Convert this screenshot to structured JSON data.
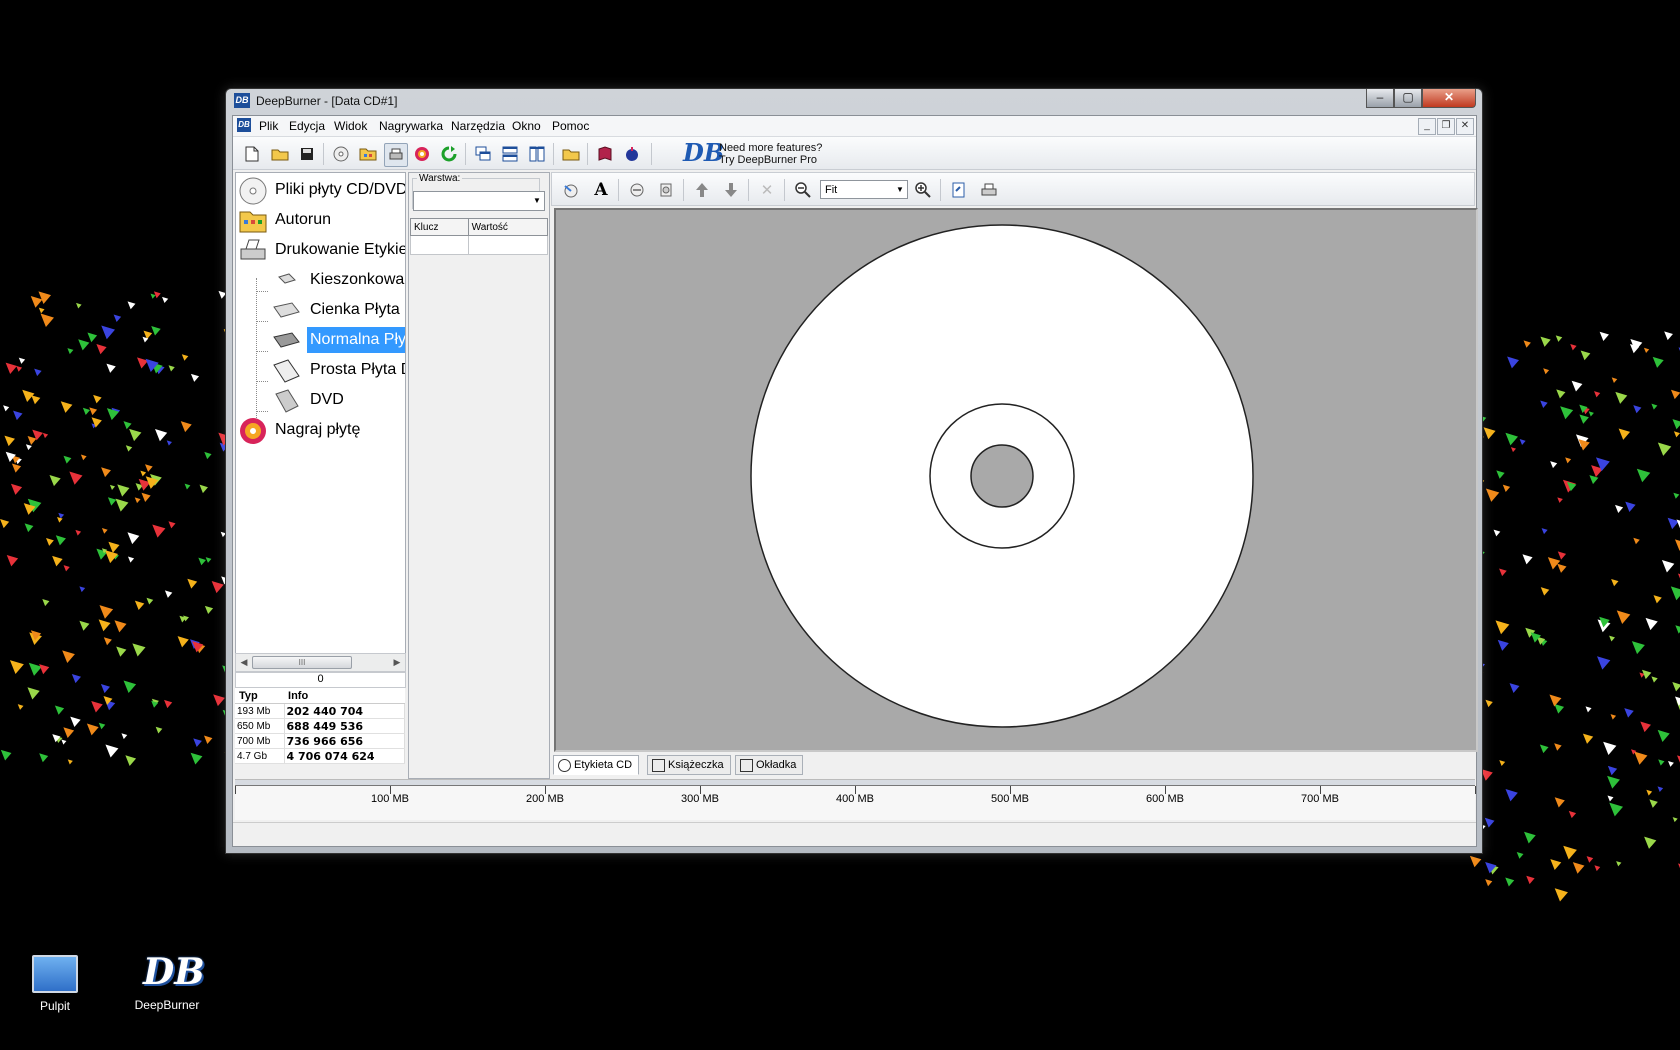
{
  "window": {
    "title": "DeepBurner - [Data CD#1]",
    "app_icon": "DB",
    "controls": {
      "minimize": "–",
      "maximize": "▢",
      "close": "✕"
    }
  },
  "menubar": {
    "items": [
      "Plik",
      "Edycja",
      "Widok",
      "Nagrywarka",
      "Narzędzia",
      "Okno",
      "Pomoc"
    ],
    "mdi": {
      "minimize": "_",
      "restore": "❐",
      "close": "✕"
    }
  },
  "toolbar": {
    "promo_logo": "DB",
    "promo_line1": "Need more features?",
    "promo_line2": "Try DeepBurner Pro"
  },
  "tree": {
    "nodes": [
      {
        "label": "Pliki płyty CD/DVD",
        "icon": "disc-icon"
      },
      {
        "label": "Autorun",
        "icon": "autorun-icon"
      },
      {
        "label": "Drukowanie Etykiet",
        "icon": "printer-icon"
      },
      {
        "label": "Kieszonkowa Płyta",
        "icon": "small-case-icon"
      },
      {
        "label": "Cienka Płyta CD",
        "icon": "slim-case-icon"
      },
      {
        "label": "Normalna Płyta",
        "icon": "normal-case-icon",
        "selected": true
      },
      {
        "label": "Prosta Płyta DVD",
        "icon": "simple-case-icon"
      },
      {
        "label": "DVD",
        "icon": "dvd-case-icon"
      },
      {
        "label": "Nagraj płytę",
        "icon": "burn-disc-icon"
      }
    ],
    "scroll_thumb": "III"
  },
  "size_panel": {
    "counter": "0",
    "headers": {
      "type": "Typ",
      "info": "Info"
    },
    "rows": [
      {
        "type": "193 Mb",
        "info": "202 440 704"
      },
      {
        "type": "650 Mb",
        "info": "688 449 536"
      },
      {
        "type": "700 Mb",
        "info": "736 966 656"
      },
      {
        "type": "4.7 Gb",
        "info": "4 706 074 624"
      }
    ]
  },
  "properties": {
    "layer_label": "Warstwa:",
    "layer_value": "",
    "key_header": "Klucz",
    "value_header": "Wartość"
  },
  "editor": {
    "zoom_value": "Fit",
    "tabs": [
      {
        "label": "Etykieta CD",
        "active": true
      },
      {
        "label": "Książeczka",
        "active": false
      },
      {
        "label": "Okładka",
        "active": false
      }
    ]
  },
  "ruler": {
    "labels": [
      "100 MB",
      "200 MB",
      "300 MB",
      "400 MB",
      "500 MB",
      "600 MB",
      "700 MB"
    ]
  },
  "desktop": {
    "icons": [
      {
        "label": "Pulpit",
        "icon": "computer-icon"
      },
      {
        "label": "DeepBurner",
        "icon": "deepburner-shortcut-icon",
        "glyph": "DB"
      }
    ]
  }
}
